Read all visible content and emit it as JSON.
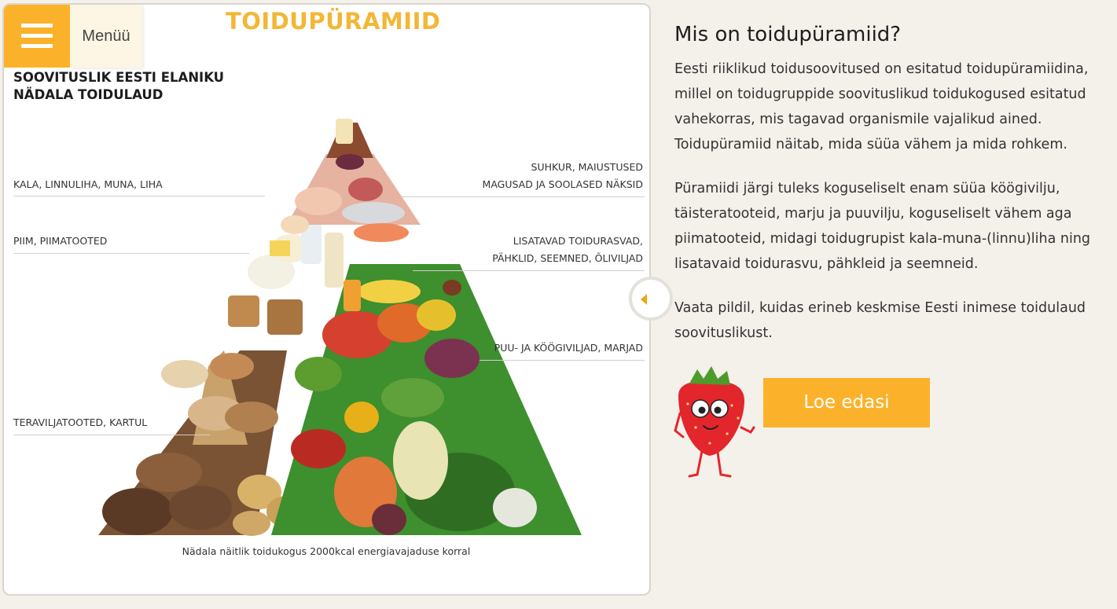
{
  "menu": {
    "label": "Menüü"
  },
  "pyramid": {
    "title": "TOIDUPÜRAMIID",
    "subtitle_line1": "SOOVITUSLIK EESTI ELANIKU",
    "subtitle_line2": "NÄDALA TOIDULAUD",
    "labels_left": [
      "KALA, LINNULIHA, MUNA, LIHA",
      "PIIM, PIIMATOOTED",
      "TERAVILJATOOTED, KARTUL"
    ],
    "labels_right": [
      {
        "line1": "SUHKUR, MAIUSTUSED",
        "line2": "MAGUSAD JA SOOLASED NÄKSID"
      },
      {
        "line1": "LISATAVAD TOIDURASVAD,",
        "line2": "PÄHKLID, SEEMNED, ÕLIVILJAD"
      },
      {
        "line1": "PUU- JA KÖÖGIVILJAD, MARJAD",
        "line2": ""
      }
    ],
    "caption": "Nädala näitlik toidukogus 2000kcal energiavajaduse korral"
  },
  "info": {
    "heading": "Mis on toidupüramiid?",
    "paragraphs": [
      "Eesti riiklikud toidusoovitused on esitatud toidupüramiidina, millel on toidugruppide soovituslikud toidukogused esitatud vahekorras, mis tagavad organismile vajalikud ained. Toidupüramiid näitab, mida süüa vähem ja mida rohkem.",
      "Püramiidi järgi tuleks koguseliselt enam süüa köögivilju, täisteratooteid, marju ja puuvilju, koguseliselt vähem aga piimatooteid, midagi toidugrupist kala-muna-(linnu)liha ning lisatavaid toidurasvu, pähkleid ja seemneid.",
      "Vaata pildil, kuidas erineb keskmise Eesti inimese toidulaud soovituslikust."
    ],
    "button_label": "Loe edasi"
  },
  "colors": {
    "accent": "#fbb22a",
    "title": "#f2b735",
    "background": "#f4f0ea"
  },
  "icons": {
    "menu": "hamburger-icon",
    "toggle": "chevron-left-icon",
    "mascot": "strawberry-mascot-icon"
  }
}
